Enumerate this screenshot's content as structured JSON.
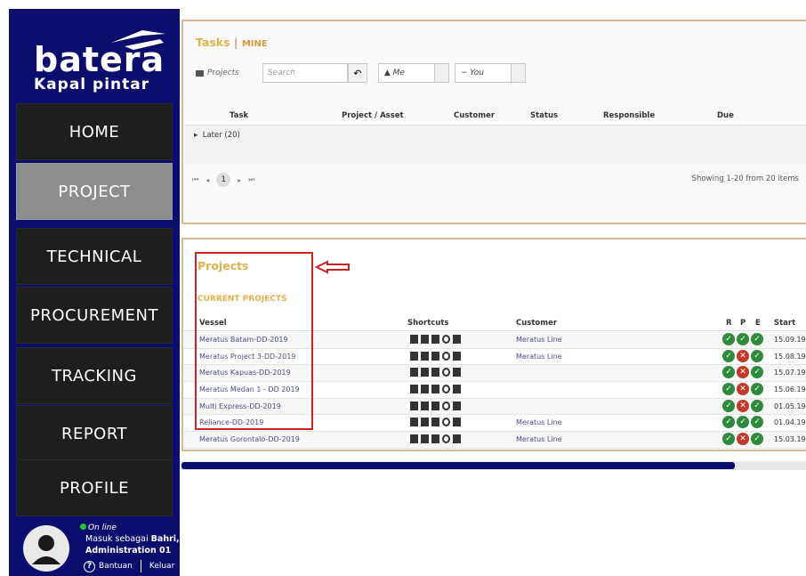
{
  "brand": {
    "name": "batera",
    "tagline": "Kapal pintar"
  },
  "nav": [
    {
      "label": "HOME"
    },
    {
      "label": "PROJECT"
    },
    {
      "label": "TECHNICAL"
    },
    {
      "label": "PROCUREMENT"
    },
    {
      "label": "TRACKING"
    },
    {
      "label": "REPORT"
    },
    {
      "label": "PROFILE"
    }
  ],
  "user": {
    "status": "On line",
    "login_prefix": "Masuk sebagai ",
    "name": "Bahri,",
    "role": "Administration 01",
    "help": "Bantuan",
    "logout": "Keluar"
  },
  "tasks": {
    "title": "Tasks",
    "title_suffix": "MINE",
    "toolbar": {
      "label": "Projects",
      "search_placeholder": "Search",
      "filter_me": "Me",
      "filter_you": "You"
    },
    "columns": [
      "Task",
      "Project / Asset",
      "Customer",
      "Status",
      "Responsible",
      "Due"
    ],
    "group": "Later (20)",
    "page": "1",
    "showing": "Showing 1-20 from 20 items"
  },
  "projects": {
    "title": "Projects",
    "current_label": "CURRENT PROJECTS",
    "columns": {
      "vessel": "Vessel",
      "shortcuts": "Shortcuts",
      "customer": "Customer",
      "r": "R",
      "p": "P",
      "e": "E",
      "start": "Start"
    },
    "rows": [
      {
        "vessel": "Meratus Batam-DD-2019",
        "customer": "Meratus Line",
        "r": "ok",
        "p": "ok",
        "e": "ok",
        "start": "15.09.19"
      },
      {
        "vessel": "Meratus Project 3-DD-2019",
        "customer": "Meratus Line",
        "r": "ok",
        "p": "x",
        "e": "ok",
        "start": "15.08.19"
      },
      {
        "vessel": "Meratus Kapuas-DD-2019",
        "customer": "",
        "r": "ok",
        "p": "x",
        "e": "ok",
        "start": "15.07.19"
      },
      {
        "vessel": "Meratus Medan 1 - DD 2019",
        "customer": "",
        "r": "ok",
        "p": "x",
        "e": "ok",
        "start": "15.06.19"
      },
      {
        "vessel": "Multi Express-DD-2019",
        "customer": "",
        "r": "ok",
        "p": "x",
        "e": "ok",
        "start": "01.05.19"
      },
      {
        "vessel": "Reliance-DD-2019",
        "customer": "Meratus Line",
        "r": "ok",
        "p": "ok",
        "e": "ok",
        "start": "01.04.19"
      },
      {
        "vessel": "Meratus Gorontalo-DD-2019",
        "customer": "Meratus Line",
        "r": "ok",
        "p": "x",
        "e": "ok",
        "start": "15.03.19"
      }
    ]
  },
  "colors": {
    "sidebar": "#0c0e6e",
    "active_nav": "#8d8d8d",
    "accent": "#e0b04a",
    "highlight": "#cc2222"
  }
}
